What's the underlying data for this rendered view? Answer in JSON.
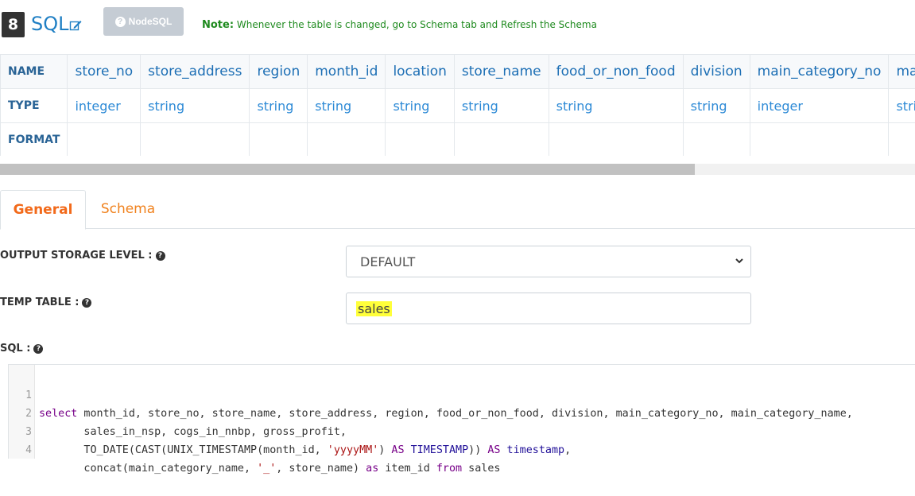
{
  "header": {
    "node_number": "8",
    "node_title": "SQL",
    "nodesql_button_label": "NodeSQL",
    "note_label": "Note:",
    "note_text": " Whenever the table is changed, go to Schema tab and Refresh the Schema"
  },
  "schema": {
    "row_headers": {
      "name": "NAME",
      "type": "TYPE",
      "format": "FORMAT"
    },
    "columns": [
      {
        "name": "store_no",
        "type": "integer",
        "format": ""
      },
      {
        "name": "store_address",
        "type": "string",
        "format": ""
      },
      {
        "name": "region",
        "type": "string",
        "format": ""
      },
      {
        "name": "month_id",
        "type": "string",
        "format": ""
      },
      {
        "name": "location",
        "type": "string",
        "format": ""
      },
      {
        "name": "store_name",
        "type": "string",
        "format": ""
      },
      {
        "name": "food_or_non_food",
        "type": "string",
        "format": ""
      },
      {
        "name": "division",
        "type": "string",
        "format": ""
      },
      {
        "name": "main_category_no",
        "type": "integer",
        "format": ""
      },
      {
        "name": "main",
        "type": "string",
        "format": ""
      }
    ]
  },
  "tabs": [
    {
      "label": "General",
      "active": true
    },
    {
      "label": "Schema",
      "active": false
    }
  ],
  "form": {
    "output_storage_level_label": "OUTPUT STORAGE LEVEL :",
    "output_storage_level_value": "DEFAULT",
    "temp_table_label": "TEMP TABLE :",
    "temp_table_value": "sales",
    "sql_label": "SQL :"
  },
  "sql_lines": [
    {
      "num": "1",
      "text": "select month_id, store_no, store_name, store_address, region, food_or_non_food, division, main_category_no, main_category_name,"
    },
    {
      "num": "2",
      "text": "       sales_in_nsp, cogs_in_nnbp, gross_profit,"
    },
    {
      "num": "3",
      "text": "       TO_DATE(CAST(UNIX_TIMESTAMP(month_id, 'yyyyMM') AS TIMESTAMP)) AS timestamp,"
    },
    {
      "num": "4",
      "text": "       concat(main_category_name, '_', store_name) as item_id from sales"
    }
  ],
  "colors": {
    "accent_orange": "#f26a1b",
    "link_blue": "#1f7fc4",
    "note_green": "#1e8a1e",
    "highlight_yellow": "#ffff3a"
  }
}
